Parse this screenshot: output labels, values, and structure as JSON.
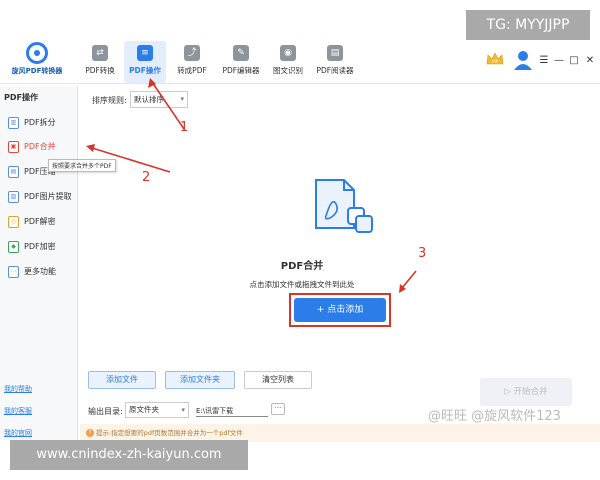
{
  "app": {
    "logo_text": "旋风PDF转换器"
  },
  "toolbar": {
    "tabs": [
      {
        "label": "PDF转换",
        "icon": "convert-icon"
      },
      {
        "label": "PDF操作",
        "icon": "document-icon",
        "active": true
      },
      {
        "label": "转成PDF",
        "icon": "to-pdf-icon"
      },
      {
        "label": "PDF编辑器",
        "icon": "edit-icon"
      },
      {
        "label": "图文识别",
        "icon": "ocr-icon"
      },
      {
        "label": "PDF阅读器",
        "icon": "reader-icon"
      }
    ],
    "window_controls": [
      "☰",
      "—",
      "□",
      "✕"
    ]
  },
  "sidebar": {
    "title": "PDF操作",
    "items": [
      {
        "label": "PDF拆分",
        "icon": "split-icon"
      },
      {
        "label": "PDF合并",
        "icon": "merge-icon",
        "active": true
      },
      {
        "label": "PDF压缩",
        "icon": "compress-icon"
      },
      {
        "label": "PDF图片提取",
        "icon": "image-extract-icon"
      },
      {
        "label": "PDF解密",
        "icon": "unlock-icon"
      },
      {
        "label": "PDF加密",
        "icon": "lock-icon"
      },
      {
        "label": "更多功能",
        "icon": "more-icon"
      }
    ],
    "tooltip": "按照要求合并多个PDF",
    "links": [
      "我的帮助",
      "我的客服",
      "我的官网"
    ]
  },
  "main": {
    "sort_label": "排序规则:",
    "sort_value": "默认排序",
    "drop_title": "PDF合并",
    "drop_subtitle": "点击添加文件或拖拽文件到此处",
    "add_button": "+ 点击添加",
    "buttons": {
      "add_file": "添加文件",
      "add_folder": "添加文件夹",
      "clear": "清空列表"
    },
    "start_button": "▷ 开始合并",
    "output_label": "输出目录:",
    "output_value": "原文件夹",
    "output_path": "E:\\讯雷下载",
    "browse": "···",
    "tip": "提示:指定想要的pdf页数范围并合并为一个pdf文件"
  },
  "annotations": {
    "n1": "1",
    "n2": "2",
    "n3": "3",
    "color": "#d9342b"
  },
  "overlays": {
    "tg_label": "TG: MYYJJPP",
    "url": "www.cnindex-zh-kaiyun.com",
    "watermark": "@旺旺 @旋风软件123"
  }
}
